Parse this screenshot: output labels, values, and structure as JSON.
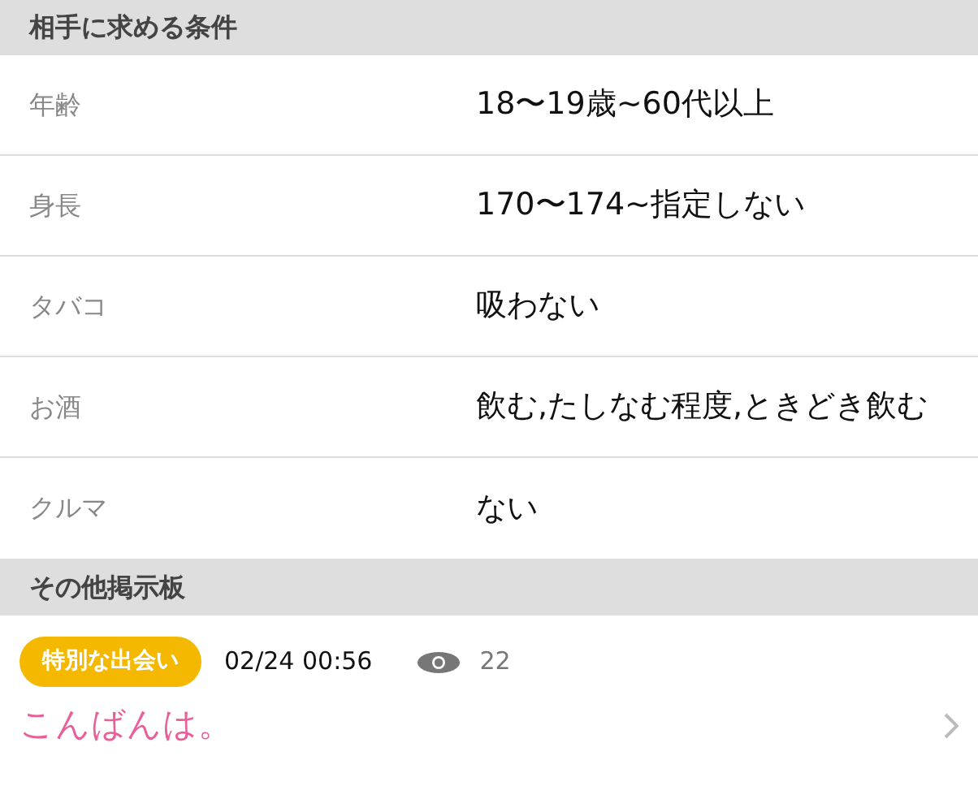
{
  "conditions": {
    "title": "相手に求める条件",
    "rows": [
      {
        "label": "年齢",
        "value": "18〜19歳~60代以上"
      },
      {
        "label": "身長",
        "value": "170〜174~指定しない"
      },
      {
        "label": "タバコ",
        "value": "吸わない"
      },
      {
        "label": "お酒",
        "value": "飲む,たしなむ程度,ときどき飲む"
      },
      {
        "label": "クルマ",
        "value": "ない"
      }
    ]
  },
  "board": {
    "title": "その他掲示板",
    "posts": [
      {
        "tag": "特別な出会い",
        "date": "02/24 00:56",
        "views": "22",
        "message": "こんばんは。"
      }
    ]
  }
}
